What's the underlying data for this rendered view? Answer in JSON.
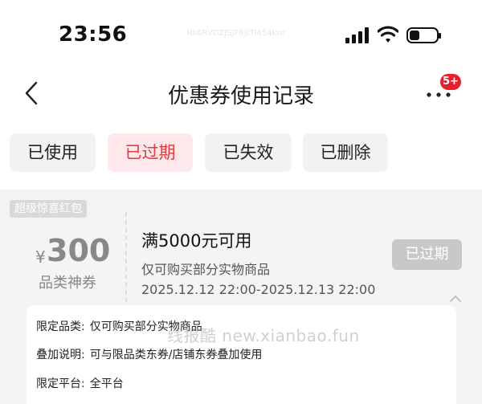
{
  "status_bar": {
    "time": "23:56",
    "faint_text": "I0i6RVDZJSJF6jLTl454knr"
  },
  "nav": {
    "title": "优惠券使用记录",
    "badge": "5+"
  },
  "tabs": [
    {
      "label": "已使用",
      "active": false
    },
    {
      "label": "已过期",
      "active": true
    },
    {
      "label": "已失效",
      "active": false
    },
    {
      "label": "已删除",
      "active": false
    }
  ],
  "coupon": {
    "tag": "超级惊喜红包",
    "currency": "¥",
    "amount": "300",
    "type": "品类神券",
    "threshold": "满5000元可用",
    "scope": "仅可购买部分实物商品",
    "validity": "2025.12.12 22:00-2025.12.13 22:00",
    "status_button": "已过期"
  },
  "details": {
    "category_label": "限定品类:",
    "category_value": "仅可购买部分实物商品",
    "stacking_label": "叠加说明:",
    "stacking_value": "可与限品类东券/店铺东券叠加使用",
    "platform_label": "限定平台:",
    "platform_value": "全平台"
  },
  "watermark": "线报酷 new.xianbao.fun",
  "colors": {
    "accent": "#e4393c",
    "badge": "#e8202a",
    "active_tab_bg": "#fde8ea"
  }
}
